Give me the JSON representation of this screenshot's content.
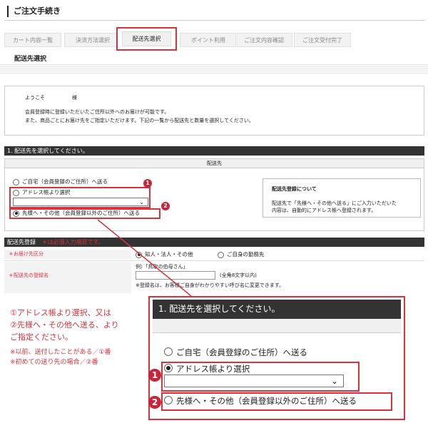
{
  "header": {
    "title": "ご注文手続き"
  },
  "steps": [
    "カート内容一覧",
    "決済方法選択",
    "配送先選択",
    "ポイント利用",
    "ご注文内容確認",
    "ご注文受付完了"
  ],
  "section_label": "配送先選択",
  "welcome": {
    "greeting": "ようこそ",
    "honorific": "様",
    "line1": "会員登録時に登録いただいたご住所以外へのお届けが可能です。",
    "line2": "また、商品ごとにお届け先をご指定いただけます。下記の一覧から配送先と数量を選択してください。"
  },
  "section1": {
    "header": "1. 配送先を選択してください。",
    "column_header": "配送先",
    "options": [
      {
        "label": "ご自宅（会員登録のご住所）へ送る",
        "checked": false
      },
      {
        "label": "アドレス帳より選択",
        "checked": false
      },
      {
        "label": "先様へ・その他（会員登録以外のご住所）へ送る",
        "checked": true
      }
    ],
    "about": {
      "title": "配送先登録について",
      "line1": "配送先で「先様へ・その他へ送る」にご入力いただいた",
      "line2": "内容は、自動的にアドレス帳へ登録されます。"
    }
  },
  "badges": {
    "one": "1",
    "two": "2"
  },
  "registration": {
    "header": "配送先登録",
    "required_note": "＊は必須入力項目です。",
    "rows": [
      {
        "label": "＊お届け先区分",
        "options": [
          "知人・法人・その他",
          "ご自身の勤務先"
        ]
      },
      {
        "label": "＊配送先の登録名",
        "example": "例）「鳥取の伯母さん」",
        "limit": "(全角8文字以内)",
        "note": "※登録名は、お客様ご自身がわかりやすい呼び名に変更できます。"
      }
    ]
  },
  "instruction": {
    "line1": "①アドレス帳より選択、又は",
    "line2": "②先様へ・その他へ送る、より",
    "line3": "ご指定ください。",
    "note1": "※以前、送付したことがある／①番",
    "note2": "※初めての送り先の場合／②番"
  },
  "callout": {
    "title": "1. 配送先を選択してください。",
    "options": [
      "ご自宅（会員登録のご住所）へ送る",
      "アドレス帳より選択",
      "先様へ・その他（会員登録以外のご住所）へ送る"
    ]
  },
  "colors": {
    "accent": "#d8323c",
    "badge": "#c8253a",
    "dark_bar": "#333333"
  }
}
